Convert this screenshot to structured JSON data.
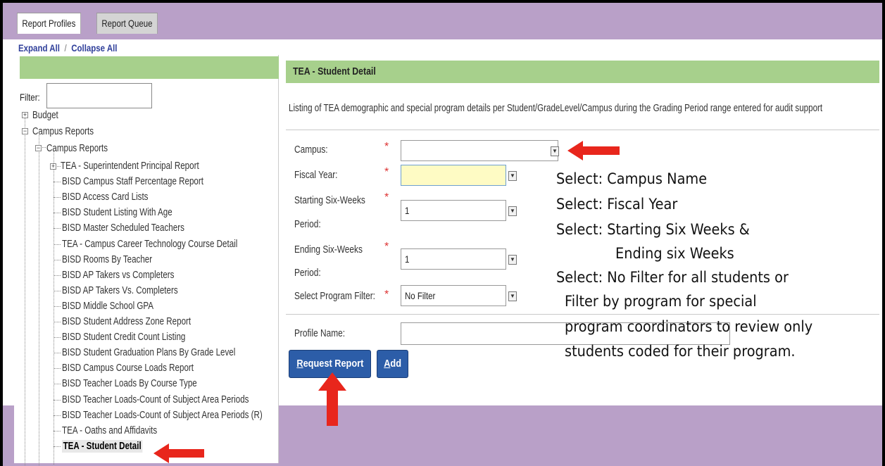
{
  "tabs": [
    {
      "label": "Report Profiles",
      "active": true
    },
    {
      "label": "Report Queue",
      "active": false
    }
  ],
  "toolbar": {
    "expand_all": "Expand All",
    "separator": "/",
    "collapse_all": "Collapse All"
  },
  "filter": {
    "label": "Filter:",
    "value": ""
  },
  "tree": {
    "budget": "Budget",
    "campus_reports": "Campus Reports",
    "campus_reports_sub": "Campus Reports",
    "items": [
      "TEA - Superintendent Principal Report",
      "BISD Campus Staff Percentage Report",
      "BISD Access Card Lists",
      "BISD Student Listing With Age",
      "BISD Master Scheduled Teachers",
      "TEA - Campus Career Technology Course Detail",
      "BISD Rooms By Teacher",
      "BISD AP Takers vs Completers",
      "BISD AP Takers Vs. Completers",
      "BISD Middle School GPA",
      "BISD Student Address Zone Report",
      "BISD Student Credit Count Listing",
      "BISD Student Graduation Plans By Grade Level",
      "BISD Campus Course Loads Report",
      "BISD Teacher Loads By Course Type",
      "BISD Teacher Loads-Count of Subject Area Periods",
      "BISD Teacher Loads-Count of Subject Area Periods (R)",
      "TEA - Oaths and Affidavits",
      "TEA - Student Detail"
    ],
    "selected_index": 18
  },
  "report": {
    "title": "TEA - Student Detail",
    "description": "Listing of TEA demographic and special program details per Student/GradeLevel/Campus during the Grading Period range entered for audit support"
  },
  "form": {
    "required_mark": "*",
    "campus_label": "Campus:",
    "campus_value": "",
    "fiscal_year_label": "Fiscal Year:",
    "fiscal_year_value": "",
    "start_label_1": "Starting Six-Weeks",
    "start_label_2": "Period:",
    "start_value": "1",
    "end_label_1": "Ending Six-Weeks",
    "end_label_2": "Period:",
    "end_value": "1",
    "program_label": "Select Program Filter:",
    "program_value": "No Filter",
    "profile_name_label": "Profile Name:",
    "profile_name_value": ""
  },
  "buttons": {
    "request_report": "Request Report",
    "request_report_key": "R",
    "request_report_rest": "equest Report",
    "add": "Add",
    "add_key": "A",
    "add_rest": "dd"
  },
  "instructions": [
    "Select: Campus Name",
    "Select: Fiscal Year",
    "Select: Starting Six Weeks &",
    "Ending six Weeks",
    "Select: No Filter for all students or",
    "Filter by program for special",
    "program coordinators to review only",
    "students coded for their program."
  ],
  "colors": {
    "accent_green": "#a7d08c",
    "frame_purple": "#b9a0c8",
    "button_blue": "#2c5da8",
    "arrow_red": "#e8261c"
  }
}
